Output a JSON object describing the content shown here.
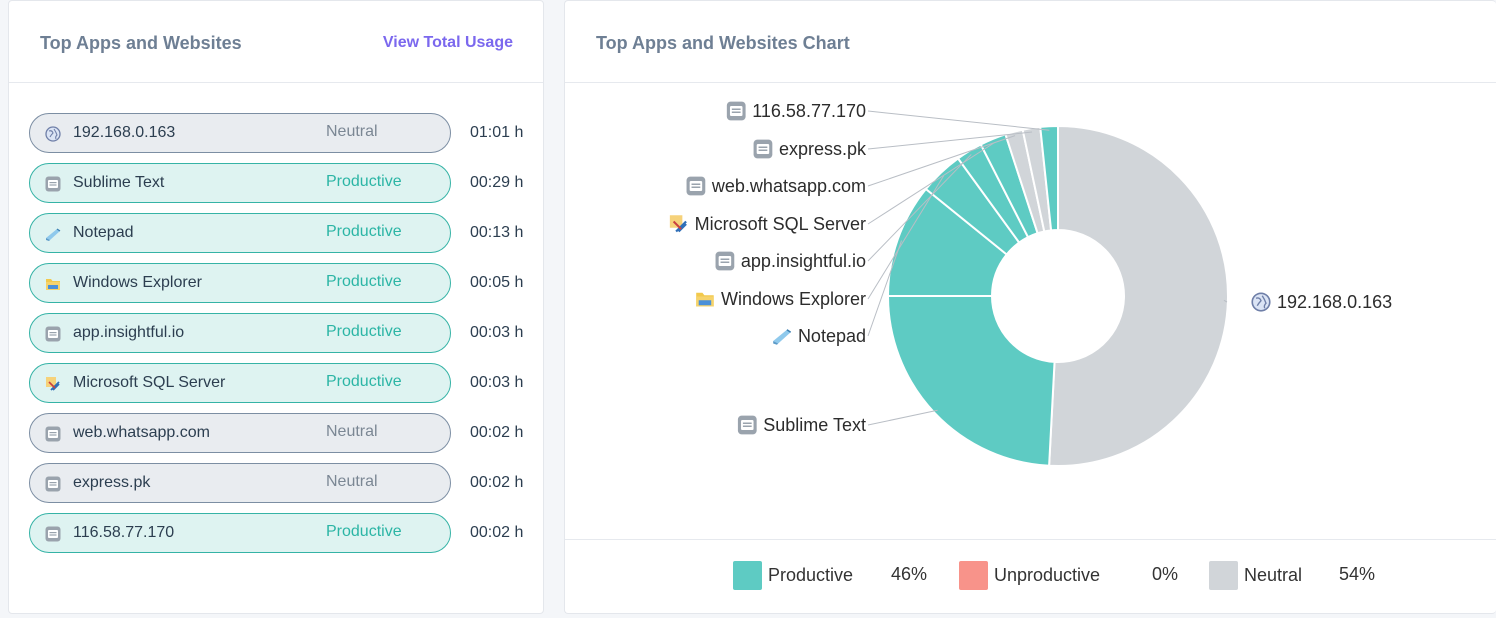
{
  "left_panel": {
    "title": "Top Apps and Websites",
    "link_label": "View Total Usage",
    "items": [
      {
        "name": "192.168.0.163",
        "status": "Neutral",
        "time": "01:01 h",
        "icon": "globe-icon"
      },
      {
        "name": "Sublime Text",
        "status": "Productive",
        "time": "00:29 h",
        "icon": "app-window-icon"
      },
      {
        "name": "Notepad",
        "status": "Productive",
        "time": "00:13 h",
        "icon": "notepad-icon"
      },
      {
        "name": "Windows Explorer",
        "status": "Productive",
        "time": "00:05 h",
        "icon": "folder-icon"
      },
      {
        "name": "app.insightful.io",
        "status": "Productive",
        "time": "00:03 h",
        "icon": "app-window-icon"
      },
      {
        "name": "Microsoft SQL Server",
        "status": "Productive",
        "time": "00:03 h",
        "icon": "sql-server-icon"
      },
      {
        "name": "web.whatsapp.com",
        "status": "Neutral",
        "time": "00:02 h",
        "icon": "app-window-icon"
      },
      {
        "name": "express.pk",
        "status": "Neutral",
        "time": "00:02 h",
        "icon": "app-window-icon"
      },
      {
        "name": "116.58.77.170",
        "status": "Productive",
        "time": "00:02 h",
        "icon": "app-window-icon"
      }
    ]
  },
  "right_panel": {
    "title": "Top Apps and Websites Chart"
  },
  "chart_data": {
    "type": "pie",
    "donut": true,
    "title": "",
    "slices": [
      {
        "label": "192.168.0.163",
        "minutes": 61,
        "category": "Neutral",
        "icon": "globe-icon"
      },
      {
        "label": "Sublime Text",
        "minutes": 29,
        "category": "Productive",
        "icon": "app-window-icon"
      },
      {
        "label": "Notepad",
        "minutes": 13,
        "category": "Productive",
        "icon": "notepad-icon"
      },
      {
        "label": "Windows Explorer",
        "minutes": 5,
        "category": "Productive",
        "icon": "folder-icon"
      },
      {
        "label": "app.insightful.io",
        "minutes": 3,
        "category": "Productive",
        "icon": "app-window-icon"
      },
      {
        "label": "Microsoft SQL Server",
        "minutes": 3,
        "category": "Productive",
        "icon": "sql-server-icon"
      },
      {
        "label": "web.whatsapp.com",
        "minutes": 2,
        "category": "Neutral",
        "icon": "app-window-icon"
      },
      {
        "label": "express.pk",
        "minutes": 2,
        "category": "Neutral",
        "icon": "app-window-icon"
      },
      {
        "label": "116.58.77.170",
        "minutes": 2,
        "category": "Productive",
        "icon": "app-window-icon"
      }
    ],
    "legend": [
      {
        "label": "Productive",
        "percent": "46%",
        "color": "#5ecbc3"
      },
      {
        "label": "Unproductive",
        "percent": "0%",
        "color": "#f8938a"
      },
      {
        "label": "Neutral",
        "percent": "54%",
        "color": "#d1d5d9"
      }
    ]
  },
  "colors": {
    "productive": "#5ecbc3",
    "unproductive": "#f8938a",
    "neutral": "#d1d5d9",
    "accent": "#7b68ee",
    "title": "#6e7f94"
  }
}
